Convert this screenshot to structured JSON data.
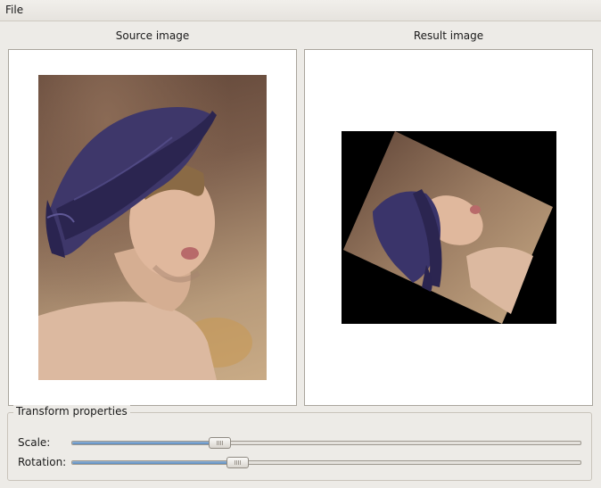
{
  "menubar": {
    "file_label": "File"
  },
  "source_panel": {
    "title": "Source image"
  },
  "result_panel": {
    "title": "Result image"
  },
  "transform_group": {
    "title": "Transform properties",
    "scale": {
      "label": "Scale:",
      "value_fraction": 0.29
    },
    "rotation": {
      "label": "Rotation:",
      "value_fraction": 0.325
    }
  }
}
